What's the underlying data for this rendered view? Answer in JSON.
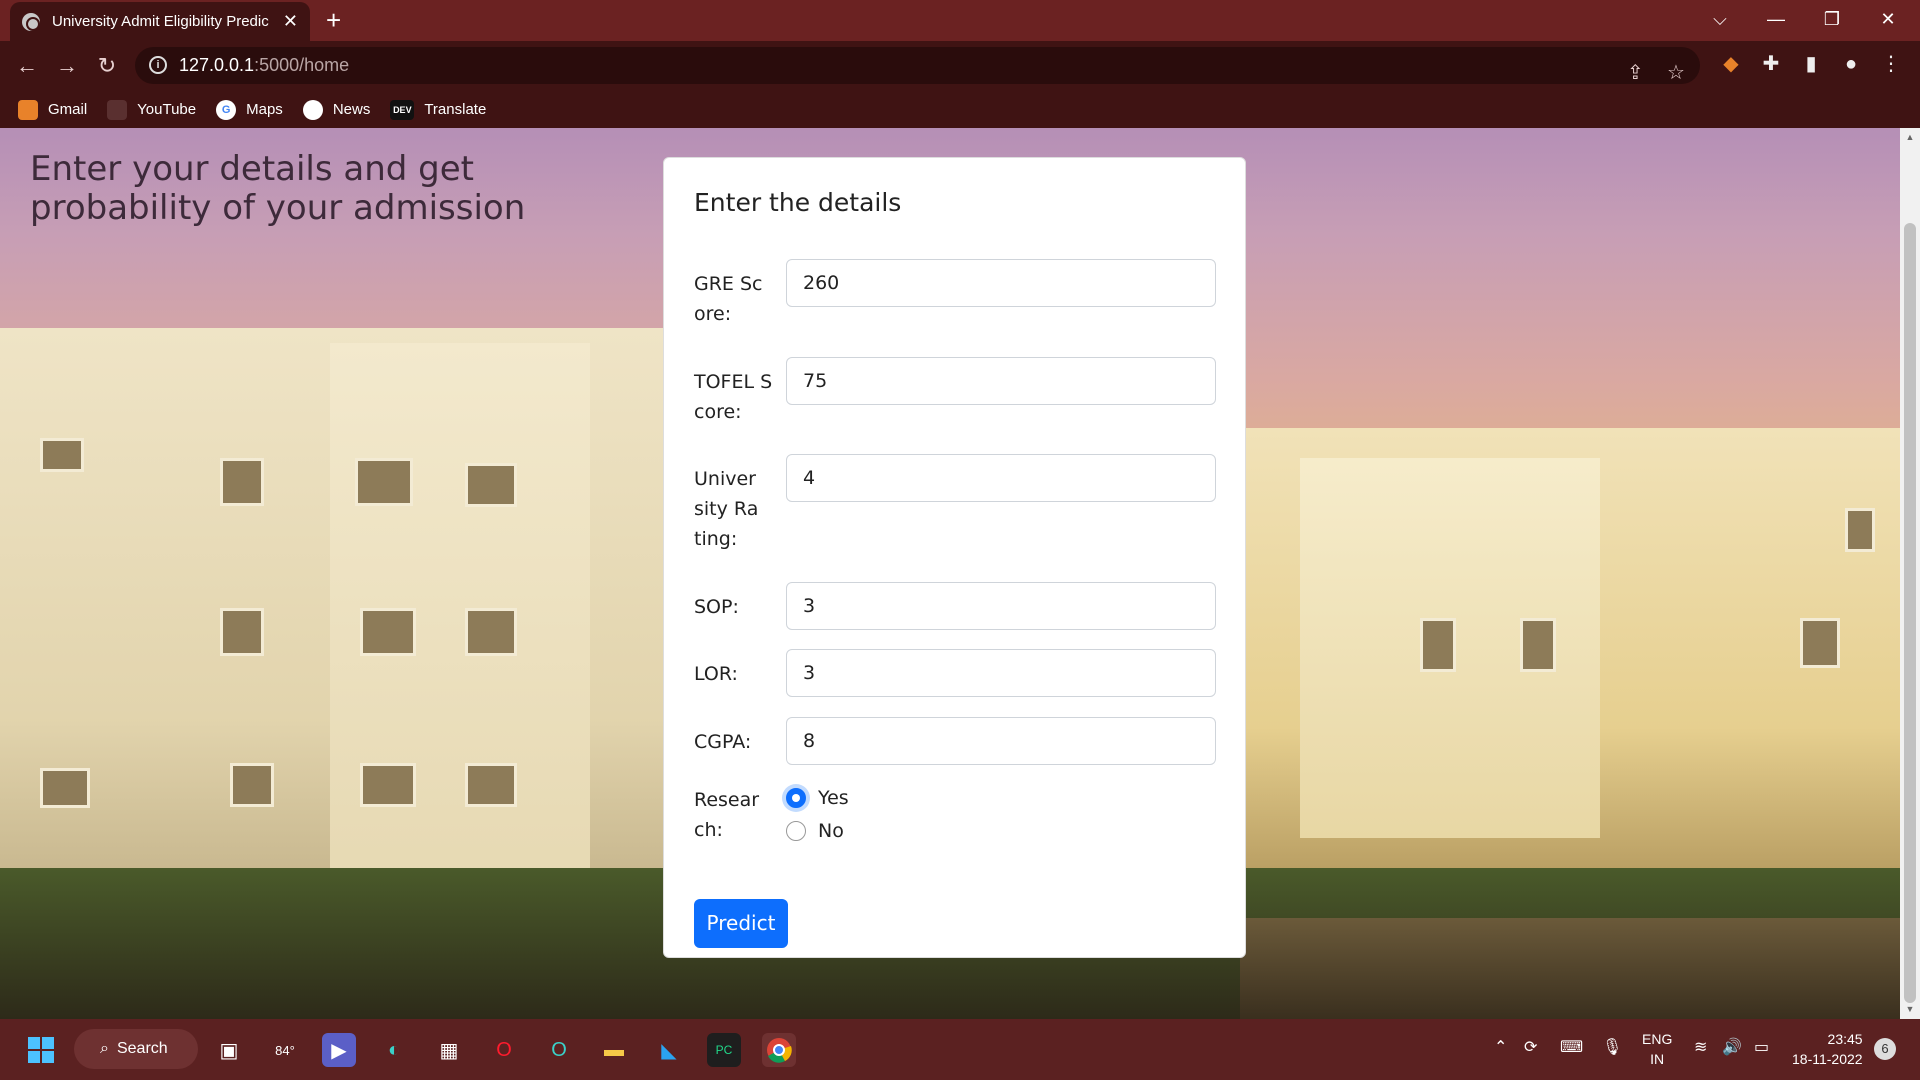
{
  "browser": {
    "tab_title": "University Admit Eligibility Predic",
    "url_host": "127.0.0.1",
    "url_path": ":5000/home",
    "bookmarks": [
      {
        "label": "Gmail",
        "icon": "metamask-fox-icon"
      },
      {
        "label": "YouTube",
        "icon": "youtube-icon"
      },
      {
        "label": "Maps",
        "icon": "google-g-icon"
      },
      {
        "label": "News",
        "icon": "github-icon"
      },
      {
        "label": "Translate",
        "icon": "dev-icon",
        "icon_text": "DEV"
      }
    ]
  },
  "page": {
    "hero_text": "Enter your details and get probability of your admission",
    "form_title": "Enter the details",
    "fields": [
      {
        "label": "GRE Score:",
        "value": "260"
      },
      {
        "label": "TOFEL Score:",
        "value": "75"
      },
      {
        "label": "University Rating:",
        "value": "4"
      },
      {
        "label": "SOP:",
        "value": "3"
      },
      {
        "label": "LOR:",
        "value": "3"
      },
      {
        "label": "CGPA:",
        "value": "8"
      }
    ],
    "research": {
      "label": "Research:",
      "options": [
        "Yes",
        "No"
      ],
      "selected": "Yes"
    },
    "submit_label": "Predict",
    "accent_color": "#0d6efd"
  },
  "taskbar": {
    "search_label": "Search",
    "weather": "84°",
    "lang_line1": "ENG",
    "lang_line2": "IN",
    "time": "23:45",
    "date": "18-11-2022",
    "notification_count": "6"
  }
}
